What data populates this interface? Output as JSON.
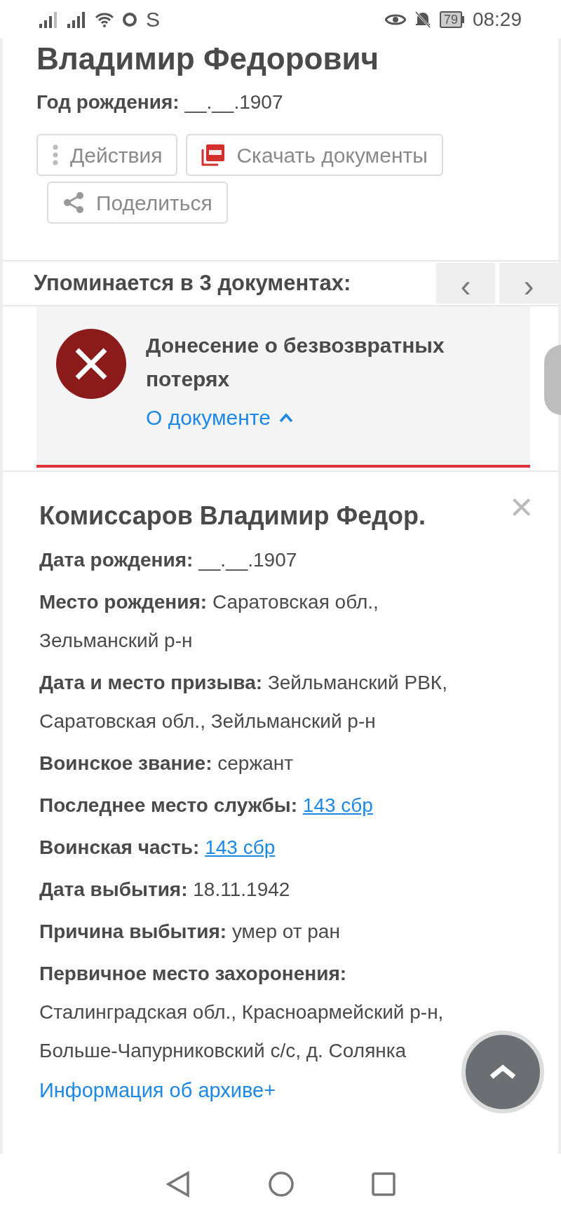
{
  "status_bar": {
    "carrier_letter": "S",
    "battery": "79",
    "time": "08:29"
  },
  "person": {
    "name": "Владимир Федорович",
    "birth_label": "Год рождения:",
    "birth_value": "__.__.1907"
  },
  "actions": [
    {
      "kind": "menu",
      "label": "Действия"
    },
    {
      "kind": "pdf",
      "label": "Скачать документы"
    },
    {
      "kind": "share",
      "label": "Поделиться"
    }
  ],
  "mentions": {
    "title": "Упоминается в 3 документах:",
    "prev": "‹",
    "next": "›"
  },
  "document": {
    "title": "Донесение о безвозвратных потерях",
    "link": "О документе",
    "expanded": true
  },
  "details": {
    "title": "Комиссаров Владимир Федор.",
    "close": "×",
    "rows": [
      {
        "label": "Дата рождения:",
        "value": "__.__.1907",
        "kind": "text"
      },
      {
        "label": "Место рождения:",
        "value": "Саратовская обл., Зельманский р-н",
        "kind": "text"
      },
      {
        "label": "Дата и место призыва:",
        "value": "Зейльманский РВК, Саратовская обл., Зейльманский р-н",
        "kind": "text"
      },
      {
        "label": "Воинское звание:",
        "value": "сержант",
        "kind": "text"
      },
      {
        "label": "Последнее место службы:",
        "value": "143 сбр",
        "kind": "link"
      },
      {
        "label": "Воинская часть:",
        "value": "143 сбр",
        "kind": "link"
      },
      {
        "label": "Дата выбытия:",
        "value": "18.11.1942",
        "kind": "text"
      },
      {
        "label": "Причина выбытия:",
        "value": "умер от ран",
        "kind": "text"
      },
      {
        "label": "Первичное место захоронения:",
        "value": "Сталинградская обл., Красноармейский р-н, Больше-Чапурниковский с/с, д. Солянка",
        "kind": "text"
      }
    ],
    "archive_link": "Информация об архиве+"
  }
}
